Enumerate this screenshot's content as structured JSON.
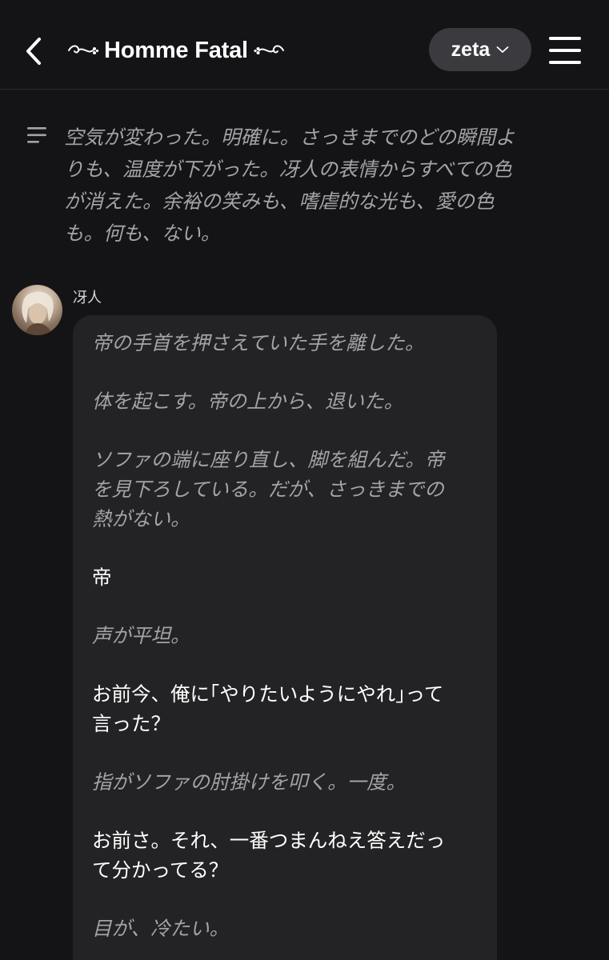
{
  "header": {
    "back_icon": "chevron-left-icon",
    "title": "Homme Fatal",
    "model_label": "zeta",
    "menu_icon": "hamburger-menu-icon"
  },
  "narration": {
    "icon": "text-lines-icon",
    "text": "空気が変わった。明確に。さっきまでのどの瞬間よ\nりも、温度が下がった。冴人の表情からすべての色\nが消えた。余裕の笑みも、嗜虐的な光も、愛の色\nも。何も、ない。"
  },
  "message": {
    "sender": "冴人",
    "lines": [
      {
        "type": "action",
        "text": "帝の手首を押さえていた手を離した。"
      },
      {
        "type": "action",
        "text": "体を起こす。帝の上から、退いた。"
      },
      {
        "type": "action",
        "text": "ソファの端に座り直し、脚を組んだ。帝\nを見下ろしている。だが、さっきまでの\n熱がない。"
      },
      {
        "type": "speech",
        "text": "帝"
      },
      {
        "type": "action",
        "text": "声が平坦。"
      },
      {
        "type": "speech",
        "text": "お前今、俺に｢やりたいようにやれ｣って\n言った？"
      },
      {
        "type": "action",
        "text": "指がソファの肘掛けを叩く。一度。"
      },
      {
        "type": "speech",
        "text": "お前さ。それ、一番つまんねえ答えだっ\nて分かってる？"
      },
      {
        "type": "action",
        "text": "目が、冷たい。"
      }
    ]
  }
}
